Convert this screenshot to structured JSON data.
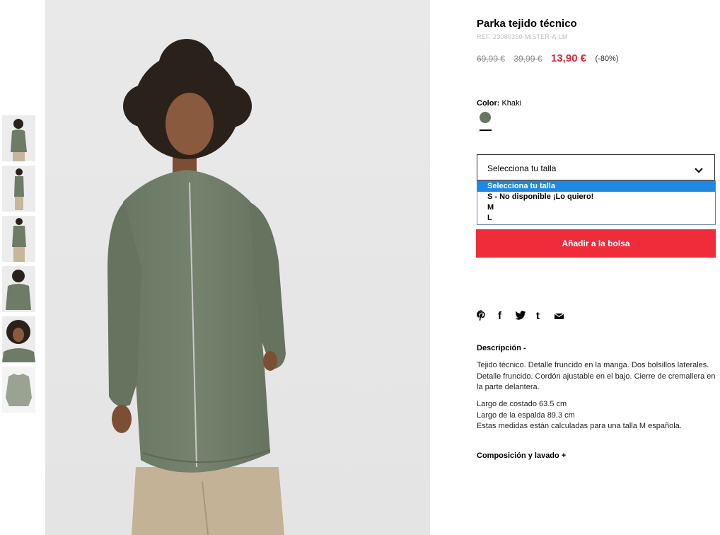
{
  "product": {
    "title": "Parka tejido técnico",
    "ref": "REF. 23080350-MISTER-A-LM",
    "price_original": "69,99 €",
    "price_previous": "39,99 €",
    "price_sale": "13,90 €",
    "discount": "(-80%)"
  },
  "color": {
    "label": "Color:",
    "value": "Khaki",
    "swatch_hex": "#687462"
  },
  "size_select": {
    "selected": "Selecciona tu talla",
    "options": [
      "Selecciona tu talla",
      "S - No disponible ¡Lo quiero!",
      "M",
      "L"
    ]
  },
  "actions": {
    "add_to_bag": "Añadir a la bolsa"
  },
  "share": {
    "icons": [
      "pinterest-icon",
      "facebook-icon",
      "twitter-icon",
      "tumblr-icon",
      "email-icon"
    ],
    "glyphs": [
      "℗",
      "f",
      "t",
      "t",
      "✉"
    ]
  },
  "description": {
    "heading": "Descripción -",
    "text": "Tejido técnico. Detalle fruncido en la manga. Dos bolsillos laterales. Detalle fruncido. Cordón ajustable en el bajo. Cierre de cremallera en la parte delantera.",
    "measure_1": "Largo de costado 63.5 cm",
    "measure_2": "Largo de la espalda 89.3 cm",
    "measure_note": "Estas medidas están calculadas para una talla M española."
  },
  "composition": {
    "heading": "Composición y lavado +"
  },
  "colors": {
    "accent_red": "#f02b3a",
    "sale_red": "#e0263a",
    "option_highlight": "#1e88e5",
    "jacket": "#6e7b66"
  }
}
